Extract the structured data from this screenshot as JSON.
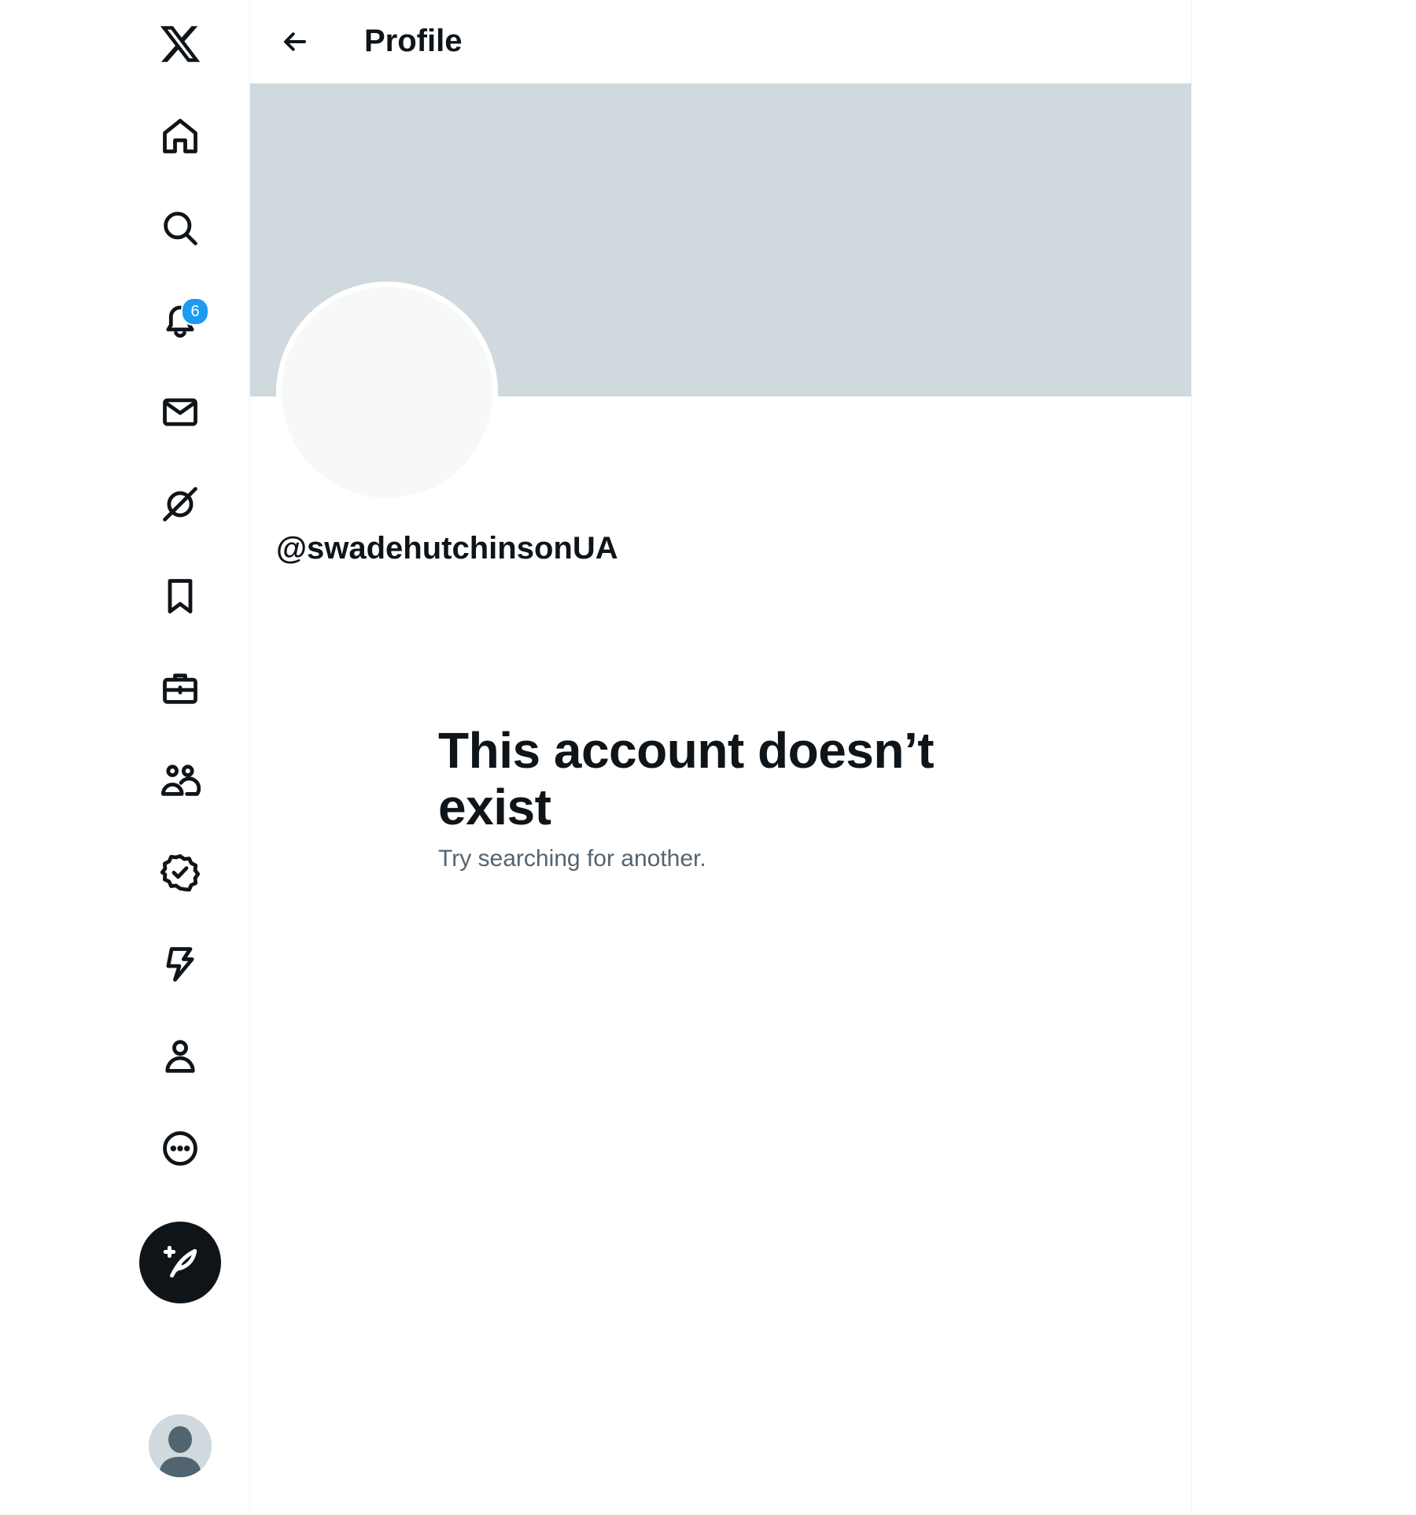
{
  "nav": {
    "logo_icon": "x-logo-icon",
    "items": [
      {
        "id": "home",
        "icon": "home-icon"
      },
      {
        "id": "explore",
        "icon": "search-icon"
      },
      {
        "id": "notifications",
        "icon": "bell-icon",
        "badge": "6"
      },
      {
        "id": "messages",
        "icon": "envelope-icon"
      },
      {
        "id": "grok",
        "icon": "grok-icon"
      },
      {
        "id": "bookmarks",
        "icon": "bookmark-icon"
      },
      {
        "id": "jobs",
        "icon": "briefcase-icon"
      },
      {
        "id": "communities",
        "icon": "people-icon"
      },
      {
        "id": "premium",
        "icon": "verified-badge-icon"
      },
      {
        "id": "verified-orgs",
        "icon": "lightning-icon"
      },
      {
        "id": "profile",
        "icon": "person-icon"
      },
      {
        "id": "more",
        "icon": "more-circle-icon"
      }
    ],
    "compose_icon": "compose-post-icon",
    "account_avatar_icon": "default-avatar-icon"
  },
  "header": {
    "back_icon": "arrow-left-icon",
    "title": "Profile"
  },
  "profile": {
    "handle": "@swadehutchinsonUA",
    "empty_state": {
      "title": "This account doesn’t exist",
      "subtitle": "Try searching for another."
    }
  },
  "colors": {
    "text_primary": "#0f1419",
    "text_secondary": "#536471",
    "banner": "#cfd9de",
    "avatar_placeholder": "#f7f9f9",
    "badge": "#1d9bf0",
    "compose_button": "#0f1419"
  }
}
